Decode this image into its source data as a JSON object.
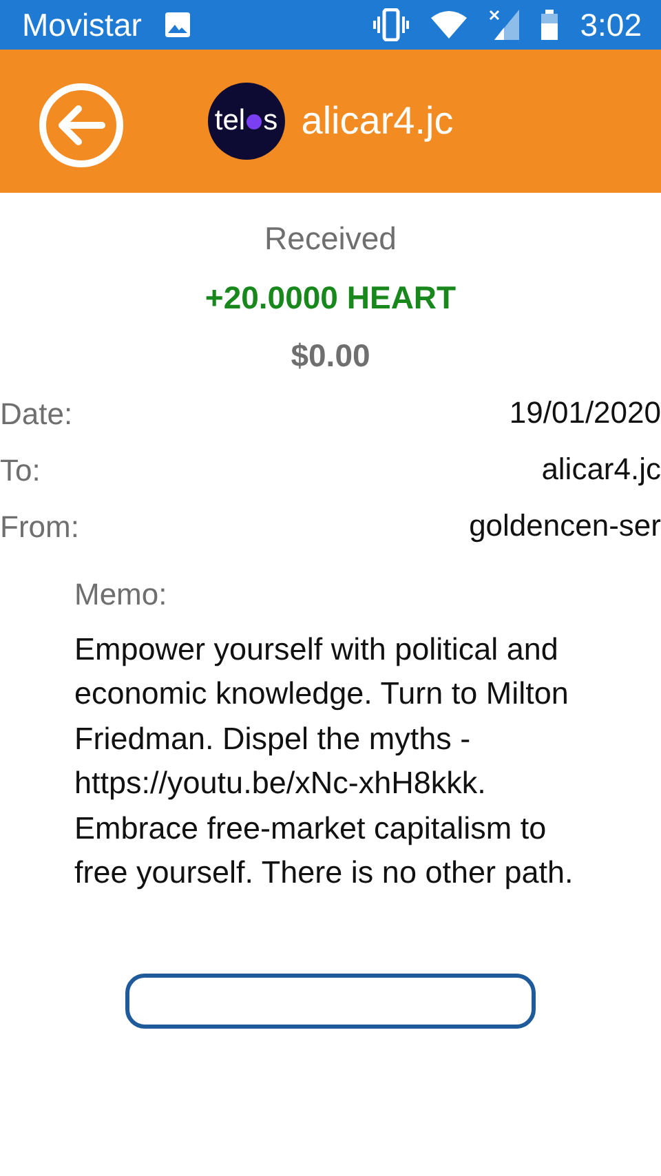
{
  "status_bar": {
    "carrier": "Movistar",
    "time": "3:02"
  },
  "header": {
    "logo": {
      "before": "tel",
      "after": "s"
    },
    "title": "alicar4.jc"
  },
  "transaction": {
    "type": "Received",
    "amount": "+20.0000 HEART",
    "fiat": "$0.00"
  },
  "details": [
    {
      "label": "Date:",
      "value": "19/01/2020"
    },
    {
      "label": "To:",
      "value": "alicar4.jc"
    },
    {
      "label": "From:",
      "value": "goldencen-ser"
    }
  ],
  "memo": {
    "label": "Memo:",
    "text": "Empower yourself with political and economic knowledge.  Turn to Milton Friedman. Dispel the myths - https://youtu.be/xNc-xhH8kkk. Embrace free-market capitalism to free yourself. There is no other path."
  }
}
